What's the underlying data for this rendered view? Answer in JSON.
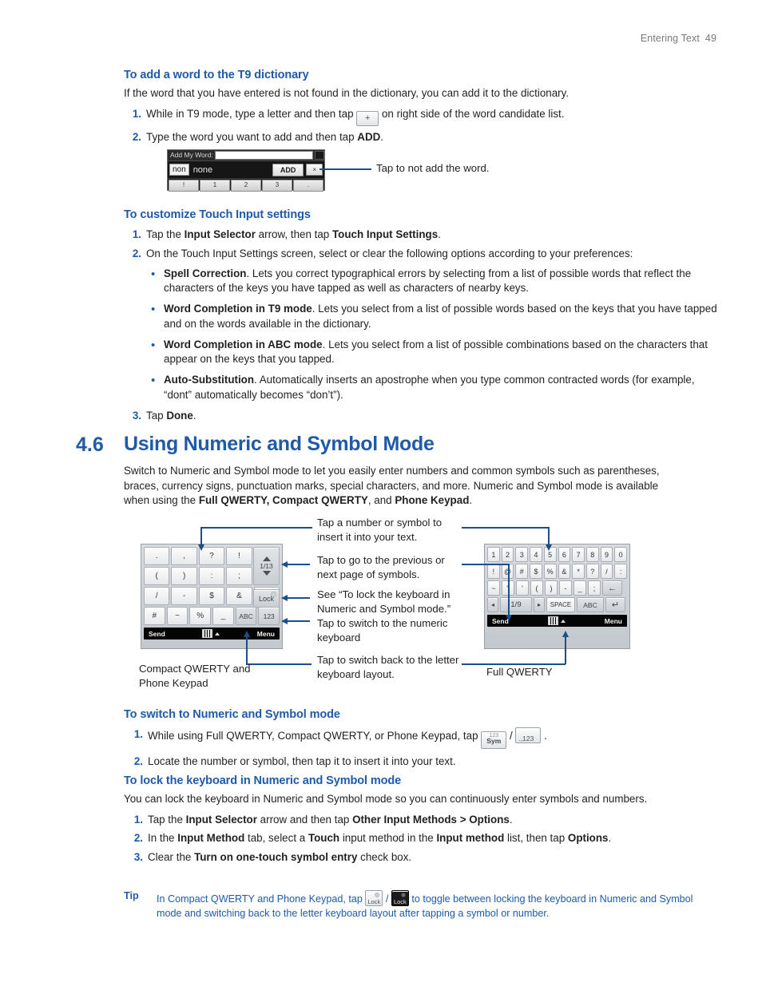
{
  "header": {
    "section": "Entering Text",
    "page": "49"
  },
  "s1": {
    "heading": "To add a word to the T9 dictionary",
    "intro": "If the word that you have entered is not found in the dictionary, you can add it to the dictionary.",
    "steps": [
      {
        "num": "1.",
        "pre": "While in T9 mode, type a letter and then tap ",
        "key": "+",
        "post": " on right side of the word candidate list."
      },
      {
        "num": "2.",
        "pre": "Type the word you want to add and then tap ",
        "bold": "ADD",
        "post": "."
      }
    ]
  },
  "addword_shot": {
    "title": "Add My Word:",
    "chip": "non",
    "word": "none",
    "add_button": "ADD",
    "close_button": "×",
    "keys": [
      "!",
      "1",
      "2",
      "3",
      "."
    ],
    "callout": "Tap to not add the word."
  },
  "s2": {
    "heading": "To customize Touch Input settings",
    "steps": [
      {
        "num": "1.",
        "parts": [
          {
            "t": "Tap the "
          },
          {
            "t": "Input Selector",
            "b": true
          },
          {
            "t": " arrow, then tap "
          },
          {
            "t": "Touch Input Settings",
            "b": true
          },
          {
            "t": "."
          }
        ]
      },
      {
        "num": "2.",
        "parts": [
          {
            "t": "On the Touch Input Settings screen, select or clear the following options according to your preferences:"
          }
        ]
      }
    ],
    "bullets": [
      {
        "bold": "Spell Correction",
        "rest": ". Lets you correct typographical errors by selecting from a list of possible words that reflect the characters of the keys you have tapped as well as characters of nearby keys."
      },
      {
        "bold": "Word Completion in T9 mode",
        "rest": ". Lets you select from a list of possible words based on the keys that you have tapped and on the words available in the dictionary."
      },
      {
        "bold": "Word Completion in ABC mode",
        "rest": ". Lets you select from a list of possible combinations based on the characters that appear on the keys that you tapped."
      },
      {
        "bold": "Auto-Substitution",
        "rest": ". Automatically inserts an apostrophe when you type common contracted words (for example, “dont” automatically becomes “don’t”)."
      }
    ],
    "step3": {
      "num": "3.",
      "pre": "Tap ",
      "bold": "Done",
      "post": "."
    }
  },
  "section46": {
    "number": "4.6",
    "title": "Using Numeric and Symbol Mode",
    "intro_1": "Switch to Numeric and Symbol mode to let you easily enter numbers and common symbols such as parentheses, braces, currency signs, punctuation marks, special characters, and more. Numeric and Symbol mode is available when using the ",
    "intro_bold_1": "Full QWERTY, Compact QWERTY",
    "intro_2": ", and ",
    "intro_bold_2": "Phone Keypad",
    "intro_3": "."
  },
  "figure": {
    "notes": [
      "Tap a number or symbol to insert it into your text.",
      "Tap to go to the previous or next page of symbols.",
      "See “To lock the keyboard in Numeric and Symbol mode.”",
      "Tap to switch to the numeric keyboard",
      "Tap to switch back to the letter keyboard layout."
    ],
    "caption_left": "Compact QWERTY and Phone Keypad",
    "caption_right": "Full QWERTY",
    "compact": {
      "rows": [
        [
          ".",
          ",",
          "?",
          "!",
          "'"
        ],
        [
          "(",
          ")",
          ":",
          ";",
          "\""
        ],
        [
          "/",
          "-",
          "$",
          "&",
          "@"
        ],
        [
          "#",
          "~",
          "%",
          "_",
          "ABC"
        ]
      ],
      "page_indicator": "1/13",
      "lock_label": "Lock",
      "num_label": "123",
      "bottom": {
        "left": "Send",
        "right": "Menu"
      }
    },
    "full": {
      "row1": [
        "1",
        "2",
        "3",
        "4",
        "5",
        "6",
        "7",
        "8",
        "9",
        "0"
      ],
      "row2": [
        "!",
        "@",
        "#",
        "$",
        "%",
        "&",
        "*",
        "?",
        "/",
        ":"
      ],
      "row3": [
        "~",
        "\"",
        "'",
        "(",
        ")",
        "-",
        "_",
        ";"
      ],
      "backspace": "←",
      "prev_arrow": "◂",
      "page_indicator": "1/9",
      "next_arrow": "▸",
      "space_label": "SPACE",
      "abc_label": "ABC",
      "enter": "↵",
      "bottom": {
        "left": "Send",
        "right": "Menu"
      }
    }
  },
  "s3": {
    "heading": "To switch to Numeric and Symbol mode",
    "step1": {
      "num": "1.",
      "pre": "While using Full QWERTY, Compact QWERTY, or Phone Keypad, tap ",
      "key1_top": "123",
      "key1_bottom": "Sym",
      "sep": " / ",
      "key2": ".,123",
      "post": " ."
    },
    "step2": {
      "num": "2.",
      "text": "Locate the number or symbol, then tap it to insert it into your text."
    }
  },
  "s4": {
    "heading": "To lock the keyboard in Numeric and Symbol mode",
    "intro": "You can lock the keyboard in Numeric and Symbol mode so you can continuously enter symbols and numbers.",
    "steps": [
      {
        "num": "1.",
        "parts": [
          {
            "t": "Tap the "
          },
          {
            "t": "Input Selector",
            "b": true
          },
          {
            "t": " arrow and then tap "
          },
          {
            "t": "Other Input Methods > Options",
            "b": true
          },
          {
            "t": "."
          }
        ]
      },
      {
        "num": "2.",
        "parts": [
          {
            "t": "In the "
          },
          {
            "t": "Input Method",
            "b": true
          },
          {
            "t": " tab, select a "
          },
          {
            "t": "Touch",
            "b": true
          },
          {
            "t": " input method in the "
          },
          {
            "t": "Input method",
            "b": true
          },
          {
            "t": " list, then tap "
          },
          {
            "t": "Options",
            "b": true
          },
          {
            "t": "."
          }
        ]
      },
      {
        "num": "3.",
        "parts": [
          {
            "t": "Clear the "
          },
          {
            "t": "Turn on one-touch symbol entry",
            "b": true
          },
          {
            "t": " check box."
          }
        ]
      }
    ]
  },
  "tip": {
    "label": "Tip",
    "pre": "In Compact QWERTY and Phone Keypad, tap ",
    "key_light": "Lock",
    "sep": " / ",
    "key_dark": "Lock",
    "post": " to toggle between locking the keyboard in Numeric and Symbol mode and switching back to the letter keyboard layout after tapping a symbol or number."
  },
  "colors": {
    "accent": "#1f5aa8",
    "text": "#231f20",
    "callout": "#1b4f8a"
  }
}
